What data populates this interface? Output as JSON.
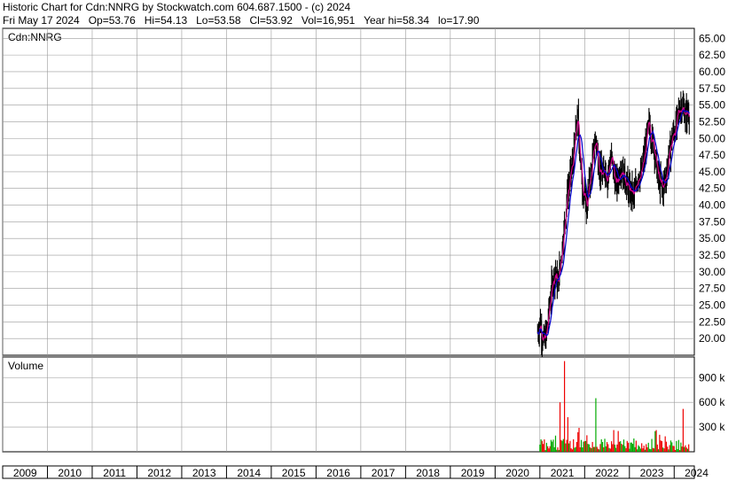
{
  "header": {
    "line1": "Historic Chart for Cdn:NNRG by Stockwatch.com 604.687.1500 - (c) 2024",
    "line2": "Fri May 17 2024   Op=53.76   Hi=54.13   Lo=53.58   Cl=53.92   Vol=16,951   Year hi=58.34   lo=17.90"
  },
  "price_panel_label": "Cdn:NNRG",
  "volume_panel_label": "Volume",
  "colors": {
    "price": "#000000",
    "ma_short": "#d0008a",
    "ma_long": "#0000cc",
    "vol_up": "#00aa00",
    "vol_down": "#ee0000",
    "grid": "#9a9a9a"
  },
  "chart_data": [
    {
      "type": "line",
      "title": "Cdn:NNRG",
      "ylim": [
        17.5,
        66.5
      ],
      "yticks": [
        "65.00",
        "62.50",
        "60.00",
        "57.50",
        "55.00",
        "52.50",
        "50.00",
        "47.50",
        "45.00",
        "42.50",
        "40.00",
        "37.50",
        "35.00",
        "32.50",
        "30.00",
        "27.50",
        "25.00",
        "22.50",
        "20.00"
      ],
      "xticks": [
        "2009",
        "2010",
        "2011",
        "2012",
        "2013",
        "2014",
        "2015",
        "2016",
        "2017",
        "2018",
        "2019",
        "2020",
        "2021",
        "2022",
        "2023",
        "2024"
      ],
      "series": [
        {
          "x": [
            2020.95,
            2021.0,
            2021.05,
            2021.1,
            2021.15,
            2021.2,
            2021.25,
            2021.3,
            2021.35,
            2021.4,
            2021.45,
            2021.5,
            2021.55,
            2021.6,
            2021.65,
            2021.7,
            2021.75,
            2021.8,
            2021.85,
            2021.9,
            2021.95,
            2022.0,
            2022.05,
            2022.1,
            2022.15,
            2022.2,
            2022.25,
            2022.3,
            2022.35,
            2022.4,
            2022.45,
            2022.5,
            2022.55,
            2022.6,
            2022.65,
            2022.7,
            2022.75,
            2022.8,
            2022.85,
            2022.9,
            2022.95,
            2023.0,
            2023.05,
            2023.1,
            2023.15,
            2023.2,
            2023.25,
            2023.3,
            2023.35,
            2023.4,
            2023.45,
            2023.5,
            2023.55,
            2023.6,
            2023.65,
            2023.7,
            2023.75,
            2023.8,
            2023.85,
            2023.9,
            2023.95,
            2024.0,
            2024.05,
            2024.1,
            2024.15,
            2024.2,
            2024.25,
            2024.3,
            2024.35
          ],
          "values": [
            21.0,
            22.5,
            20.5,
            19.5,
            21.0,
            24.0,
            27.0,
            29.0,
            30.0,
            28.0,
            31.0,
            34.0,
            37.0,
            41.0,
            43.0,
            45.0,
            47.0,
            51.0,
            53.0,
            47.0,
            43.0,
            41.0,
            40.0,
            43.0,
            45.0,
            48.0,
            50.0,
            47.0,
            45.0,
            44.0,
            46.0,
            44.0,
            46.0,
            47.0,
            45.0,
            43.0,
            44.0,
            46.0,
            45.0,
            44.0,
            43.0,
            42.0,
            42.0,
            41.0,
            43.0,
            45.0,
            44.0,
            46.0,
            48.0,
            51.0,
            52.0,
            50.0,
            49.0,
            46.0,
            44.0,
            43.0,
            42.5,
            44.0,
            46.0,
            48.0,
            50.0,
            51.0,
            52.0,
            54.0,
            55.0,
            54.5,
            53.5,
            54.0,
            53.9
          ]
        }
      ]
    },
    {
      "type": "bar",
      "title": "Volume",
      "ylim": [
        0,
        1150000
      ],
      "yticks": [
        "900 k",
        "600 k",
        "300 k"
      ],
      "note_peak_values": [
        1100000,
        650000,
        600000,
        520000,
        420000
      ]
    }
  ]
}
